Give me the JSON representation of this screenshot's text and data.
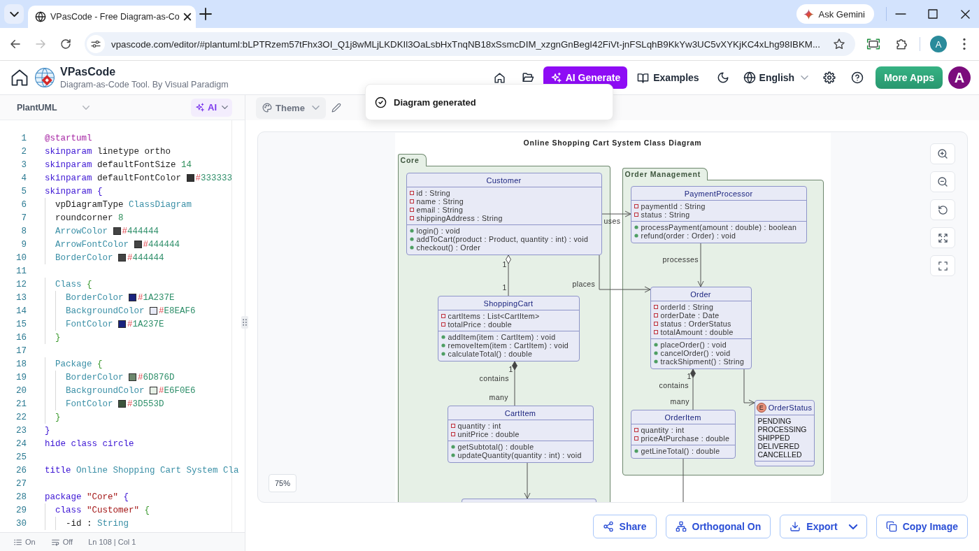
{
  "browser": {
    "tabs": [
      {
        "title": "VPasCode - Free Diagram-as-Co",
        "selected": true
      }
    ],
    "ask_gemini": "Ask Gemini",
    "navigation": [
      {
        "kind": "back",
        "disabled": false
      },
      {
        "kind": "forward",
        "disabled": true
      },
      {
        "kind": "reload",
        "disabled": false
      }
    ],
    "url": "vpascode.com/editor/#plantuml:bLPTRzem57tFhx3OI_Q1j8wMLjLKDKIl3OaLsbHxTnqNB18xSsmcDIM_xzgnGnBegI42FiVt-jnFSLqhB9KkYw3UC5vXYKjKC4xLhg98IBKM...",
    "profile_initial": "A"
  },
  "app_header": {
    "name": "VPasCode",
    "tagline": "Diagram-as-Code Tool. By Visual Paradigm",
    "ai_generate": "AI Generate",
    "examples": "Examples",
    "language": "English",
    "more_apps": "More Apps",
    "account_initial": "A"
  },
  "toast": {
    "message": "Diagram generated"
  },
  "editor": {
    "language": "PlantUML",
    "ai_button": "AI",
    "lines": [
      {
        "number": "1",
        "tokens": [
          {
            "kind": "directive",
            "text": "@startuml"
          }
        ]
      },
      {
        "number": "2",
        "tokens": [
          {
            "kind": "keyword",
            "text": "skinparam"
          },
          {
            "kind": "plain",
            "text": " linetype ortho"
          }
        ]
      },
      {
        "number": "3",
        "tokens": [
          {
            "kind": "keyword",
            "text": "skinparam"
          },
          {
            "kind": "plain",
            "text": " defaultFontSize "
          },
          {
            "kind": "number",
            "text": "14"
          }
        ]
      },
      {
        "number": "4",
        "tokens": [
          {
            "kind": "keyword",
            "text": "skinparam"
          },
          {
            "kind": "plain",
            "text": " defaultFontColor "
          },
          {
            "kind": "color",
            "text": "#333333",
            "color": "#333333"
          }
        ]
      },
      {
        "number": "5",
        "tokens": [
          {
            "kind": "keyword",
            "text": "skinparam"
          },
          {
            "kind": "brace1",
            "text": " {"
          }
        ]
      },
      {
        "number": "6",
        "tokens": [
          {
            "kind": "plain",
            "text": "  vpDiagramType "
          },
          {
            "kind": "ident",
            "text": "ClassDiagram"
          }
        ]
      },
      {
        "number": "7",
        "tokens": [
          {
            "kind": "plain",
            "text": "  roundcorner "
          },
          {
            "kind": "number",
            "text": "8"
          }
        ]
      },
      {
        "number": "8",
        "tokens": [
          {
            "kind": "ident",
            "text": "  ArrowColor "
          },
          {
            "kind": "color",
            "text": "#444444",
            "color": "#444444"
          }
        ]
      },
      {
        "number": "9",
        "tokens": [
          {
            "kind": "ident",
            "text": "  ArrowFontColor "
          },
          {
            "kind": "color",
            "text": "#444444",
            "color": "#444444"
          }
        ]
      },
      {
        "number": "10",
        "tokens": [
          {
            "kind": "ident",
            "text": "  BorderColor "
          },
          {
            "kind": "color",
            "text": "#444444",
            "color": "#444444"
          }
        ]
      },
      {
        "number": "11"
      },
      {
        "number": "12",
        "tokens": [
          {
            "kind": "ident",
            "text": "  Class "
          },
          {
            "kind": "brace2",
            "text": "{"
          }
        ]
      },
      {
        "number": "13",
        "tokens": [
          {
            "kind": "ident",
            "text": "    BorderColor "
          },
          {
            "kind": "color",
            "text": "#1A237E",
            "color": "#1a237e"
          }
        ]
      },
      {
        "number": "14",
        "tokens": [
          {
            "kind": "ident",
            "text": "    BackgroundColor "
          },
          {
            "kind": "color",
            "text": "#E8EAF6",
            "color": "#e8eaf6"
          }
        ]
      },
      {
        "number": "15",
        "tokens": [
          {
            "kind": "ident",
            "text": "    FontColor "
          },
          {
            "kind": "color",
            "text": "#1A237E",
            "color": "#1a237e"
          }
        ]
      },
      {
        "number": "16",
        "tokens": [
          {
            "kind": "brace2",
            "text": "  }"
          }
        ]
      },
      {
        "number": "17"
      },
      {
        "number": "18",
        "tokens": [
          {
            "kind": "ident",
            "text": "  Package "
          },
          {
            "kind": "brace2",
            "text": "{"
          }
        ]
      },
      {
        "number": "19",
        "tokens": [
          {
            "kind": "ident",
            "text": "    BorderColor "
          },
          {
            "kind": "color",
            "text": "#6D876D",
            "color": "#6d876d"
          }
        ]
      },
      {
        "number": "20",
        "tokens": [
          {
            "kind": "ident",
            "text": "    BackgroundColor "
          },
          {
            "kind": "color",
            "text": "#E6F0E6",
            "color": "#e6f0e6"
          }
        ]
      },
      {
        "number": "21",
        "tokens": [
          {
            "kind": "ident",
            "text": "    FontColor "
          },
          {
            "kind": "color",
            "text": "#3D553D",
            "color": "#3d553d"
          }
        ]
      },
      {
        "number": "22",
        "tokens": [
          {
            "kind": "brace2",
            "text": "  }"
          }
        ]
      },
      {
        "number": "23",
        "tokens": [
          {
            "kind": "brace1",
            "text": "}"
          }
        ]
      },
      {
        "number": "24",
        "tokens": [
          {
            "kind": "keyword",
            "text": "hide class circle"
          }
        ]
      },
      {
        "number": "25"
      },
      {
        "number": "26",
        "tokens": [
          {
            "kind": "keyword",
            "text": "title"
          },
          {
            "kind": "ident",
            "text": " Online Shopping Cart System Cla"
          }
        ]
      },
      {
        "number": "27"
      },
      {
        "number": "28",
        "tokens": [
          {
            "kind": "keyword",
            "text": "package"
          },
          {
            "kind": "string",
            "text": " \"Core\""
          },
          {
            "kind": "brace1",
            "text": " {"
          }
        ]
      },
      {
        "number": "29",
        "tokens": [
          {
            "kind": "keyword",
            "text": "  class"
          },
          {
            "kind": "string",
            "text": " \"Customer\""
          },
          {
            "kind": "brace2",
            "text": " {"
          }
        ]
      },
      {
        "number": "30",
        "tokens": [
          {
            "kind": "plain",
            "text": "    -id : "
          },
          {
            "kind": "ident",
            "text": "String"
          }
        ]
      }
    ],
    "status_bar": {
      "toggles": [
        {
          "kind": "line_numbers",
          "label": "On"
        },
        {
          "kind": "word_wrap",
          "label": "Off"
        }
      ],
      "cursor": "Ln 108 | Col 1"
    }
  },
  "preview": {
    "theme_button": "Theme",
    "zoom_level": "75%",
    "diagram": {
      "title": "Online Shopping Cart System Class Diagram",
      "packages": [
        {
          "name": "Core",
          "classes": [
            {
              "kind": "class",
              "name": "Customer",
              "attributes": [
                {
                  "kind": "private",
                  "text": "id : String"
                },
                {
                  "kind": "private",
                  "text": "name : String"
                },
                {
                  "kind": "private",
                  "text": "email : String"
                },
                {
                  "kind": "private",
                  "text": "shippingAddress : String"
                }
              ],
              "methods": [
                {
                  "kind": "public",
                  "text": "login() : void"
                },
                {
                  "kind": "public",
                  "text": "addToCart(product : Product, quantity : int) : void"
                },
                {
                  "kind": "public",
                  "text": "checkout() : Order"
                }
              ]
            },
            {
              "kind": "class",
              "name": "ShoppingCart",
              "attributes": [
                {
                  "kind": "private",
                  "text": "cartItems : List<CartItem>"
                },
                {
                  "kind": "private",
                  "text": "totalPrice : double"
                }
              ],
              "methods": [
                {
                  "kind": "public",
                  "text": "addItem(item : CartItem) : void"
                },
                {
                  "kind": "public",
                  "text": "removeItem(item : CartItem) : void"
                },
                {
                  "kind": "public",
                  "text": "calculateTotal() : double"
                }
              ]
            },
            {
              "kind": "class",
              "name": "CartItem",
              "attributes": [
                {
                  "kind": "private",
                  "text": "quantity : int"
                },
                {
                  "kind": "private",
                  "text": "unitPrice : double"
                }
              ],
              "methods": [
                {
                  "kind": "public",
                  "text": "getSubtotal() : double"
                },
                {
                  "kind": "public",
                  "text": "updateQuantity(quantity : int) : void"
                }
              ]
            },
            {
              "kind": "cut_off"
            }
          ]
        },
        {
          "name": "Order Management",
          "classes": [
            {
              "kind": "class",
              "name": "PaymentProcessor",
              "attributes": [
                {
                  "kind": "private",
                  "text": "paymentId : String"
                },
                {
                  "kind": "private",
                  "text": "status : String"
                }
              ],
              "methods": [
                {
                  "kind": "public",
                  "text": "processPayment(amount : double) : boolean"
                },
                {
                  "kind": "public",
                  "text": "refund(order : Order) : void"
                }
              ]
            },
            {
              "kind": "class",
              "name": "Order",
              "attributes": [
                {
                  "kind": "private",
                  "text": "orderId : String"
                },
                {
                  "kind": "private",
                  "text": "orderDate : Date"
                },
                {
                  "kind": "private",
                  "text": "status : OrderStatus"
                },
                {
                  "kind": "private",
                  "text": "totalAmount : double"
                }
              ],
              "methods": [
                {
                  "kind": "public",
                  "text": "placeOrder() : void"
                },
                {
                  "kind": "public",
                  "text": "cancelOrder() : void"
                },
                {
                  "kind": "public",
                  "text": "trackShipment() : String"
                }
              ]
            },
            {
              "kind": "class",
              "name": "OrderItem",
              "attributes": [
                {
                  "kind": "private",
                  "text": "quantity : int"
                },
                {
                  "kind": "private",
                  "text": "priceAtPurchase : double"
                }
              ],
              "methods": [
                {
                  "kind": "public",
                  "text": "getLineTotal() : double"
                }
              ]
            },
            {
              "kind": "enum",
              "spot": "E",
              "name": "OrderStatus",
              "values": [
                "PENDING",
                "PROCESSING",
                "SHIPPED",
                "DELIVERED",
                "CANCELLED"
              ]
            }
          ]
        }
      ],
      "relations": [
        {
          "kind": "association",
          "label": "uses"
        },
        {
          "kind": "association",
          "label": "places"
        },
        {
          "kind": "aggregation",
          "source_multiplicity": "1",
          "target_multiplicity": "1"
        },
        {
          "kind": "composition",
          "label": "contains",
          "source_multiplicity": "1",
          "target_multiplicity": "many"
        },
        {
          "kind": "association"
        },
        {
          "kind": "association",
          "label": "processes"
        },
        {
          "kind": "composition",
          "label": "contains",
          "source_multiplicity": "1",
          "target_multiplicity": "many"
        },
        {
          "kind": "association"
        },
        {
          "kind": "line"
        }
      ]
    },
    "actions": [
      {
        "kind": "share",
        "label": "Share"
      },
      {
        "kind": "orthogonal",
        "label": "Orthogonal On"
      },
      {
        "kind": "export",
        "label": "Export",
        "menu": true
      },
      {
        "kind": "copy",
        "label": "Copy Image"
      }
    ]
  }
}
